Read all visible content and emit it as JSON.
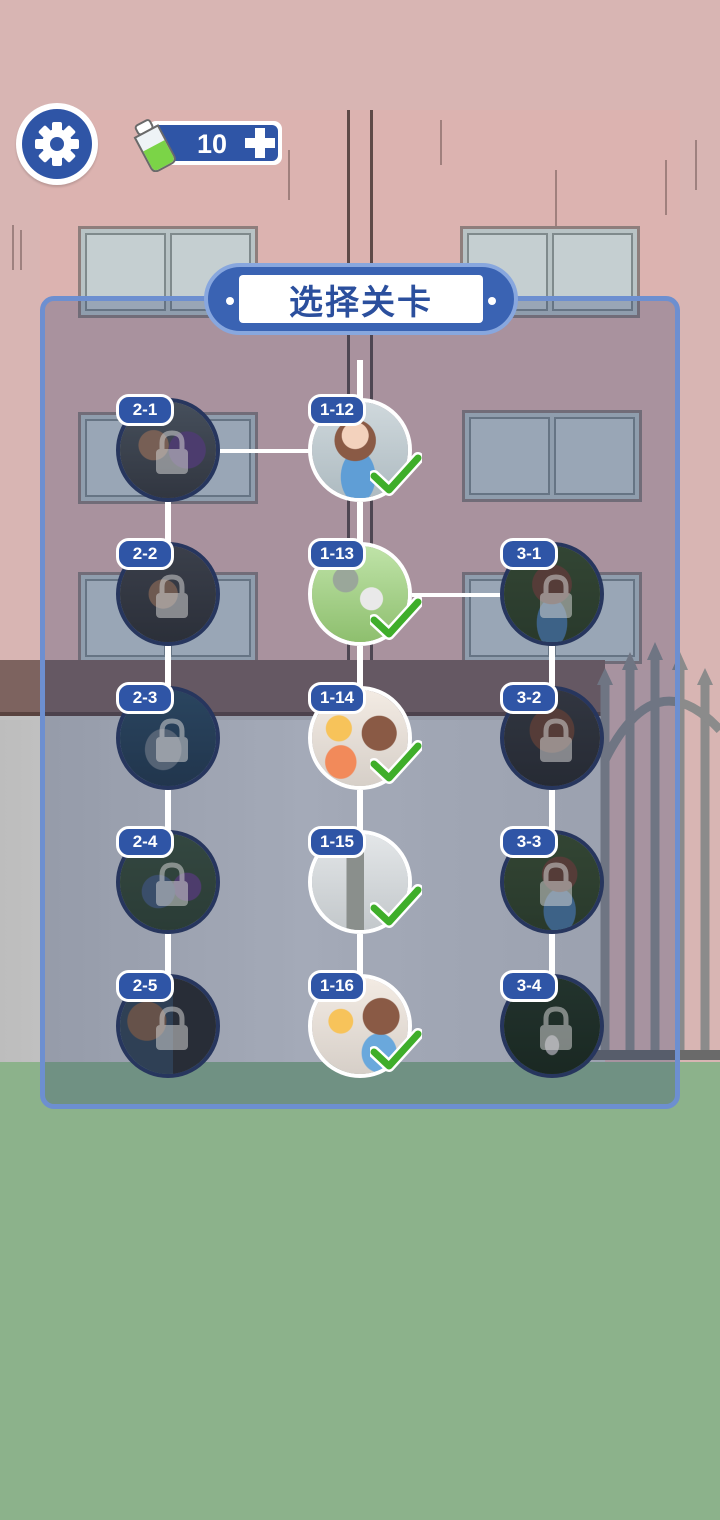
{
  "hud": {
    "potion_count": "10",
    "settings_icon": "gear-icon",
    "add_icon": "plus-icon",
    "potion_icon": "green-potion-bottle-icon"
  },
  "panel": {
    "title": "选择关卡"
  },
  "levels": {
    "l2_1": {
      "label": "2-1",
      "state": "locked"
    },
    "l2_2": {
      "label": "2-2",
      "state": "locked"
    },
    "l2_3": {
      "label": "2-3",
      "state": "locked"
    },
    "l2_4": {
      "label": "2-4",
      "state": "locked"
    },
    "l2_5": {
      "label": "2-5",
      "state": "locked"
    },
    "l1_12": {
      "label": "1-12",
      "state": "completed"
    },
    "l1_13": {
      "label": "1-13",
      "state": "completed"
    },
    "l1_14": {
      "label": "1-14",
      "state": "completed"
    },
    "l1_15": {
      "label": "1-15",
      "state": "completed"
    },
    "l1_16": {
      "label": "1-16",
      "state": "completed"
    },
    "l3_1": {
      "label": "3-1",
      "state": "locked"
    },
    "l3_2": {
      "label": "3-2",
      "state": "locked"
    },
    "l3_3": {
      "label": "3-3",
      "state": "locked"
    },
    "l3_4": {
      "label": "3-4",
      "state": "locked"
    }
  },
  "colors": {
    "accent": "#2f55a6",
    "panel_border": "#6d8fd0",
    "check": "#3fae2a",
    "grass": "#8cb28b",
    "wall": "#d8b5b3"
  }
}
